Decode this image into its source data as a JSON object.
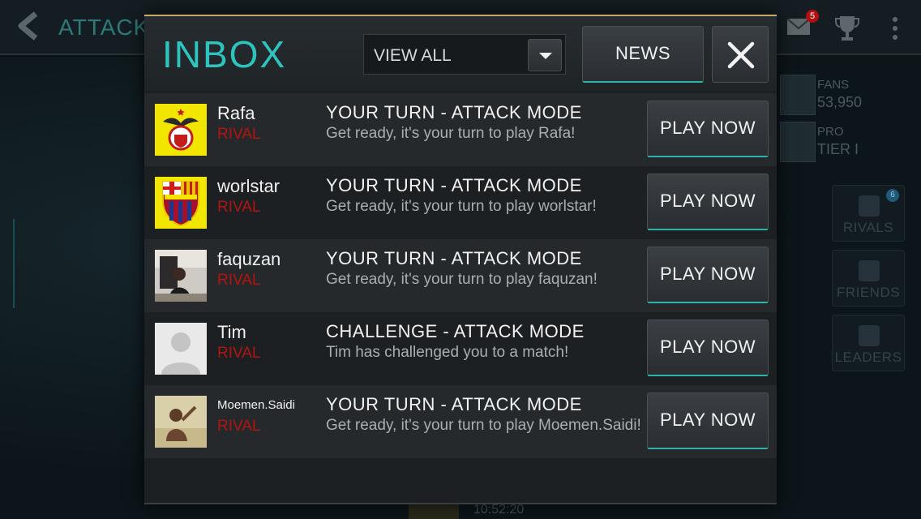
{
  "background": {
    "screen_title": "ATTACK",
    "mail_badge": "5",
    "stats": [
      {
        "label": "FANS",
        "value": "53,950"
      },
      {
        "label": "PRO",
        "value": "TIER I"
      }
    ],
    "tiles": [
      {
        "label": "RIVALS",
        "badge": "6"
      },
      {
        "label": "FRIENDS"
      },
      {
        "label": "LEADERS"
      }
    ],
    "bottom_text": "10:52:20"
  },
  "inbox": {
    "title": "INBOX",
    "filter_value": "VIEW ALL",
    "news_label": "NEWS"
  },
  "messages": [
    {
      "name": "Rafa",
      "role": "RIVAL",
      "title": "YOUR TURN - ATTACK MODE",
      "body": "Get ready, it's your turn to play Rafa!",
      "button": "PLAY NOW",
      "avatar": "benfica-crest-icon"
    },
    {
      "name": "worlstar",
      "role": "RIVAL",
      "title": "YOUR TURN - ATTACK MODE",
      "body": "Get ready, it's your turn to play worlstar!",
      "button": "PLAY NOW",
      "avatar": "barcelona-crest-icon"
    },
    {
      "name": "faquzan",
      "role": "RIVAL",
      "title": "YOUR TURN - ATTACK MODE",
      "body": "Get ready, it's your turn to play faquzan!",
      "button": "PLAY NOW",
      "avatar": "user-photo"
    },
    {
      "name": "Tim",
      "role": "RIVAL",
      "title": "CHALLENGE - ATTACK MODE",
      "body": "Tim has challenged you to a match!",
      "button": "PLAY NOW",
      "avatar": "default-avatar-icon"
    },
    {
      "name": "Moemen.Saidi",
      "role": "RIVAL",
      "title": "YOUR TURN - ATTACK MODE",
      "body": "Get ready, it's your turn to play Moemen.Saidi!",
      "button": "PLAY NOW",
      "avatar": "user-photo"
    }
  ],
  "colors": {
    "accent": "#2ec4be",
    "rival_red": "#b3140f",
    "modal_top_border": "#c7a86b"
  }
}
